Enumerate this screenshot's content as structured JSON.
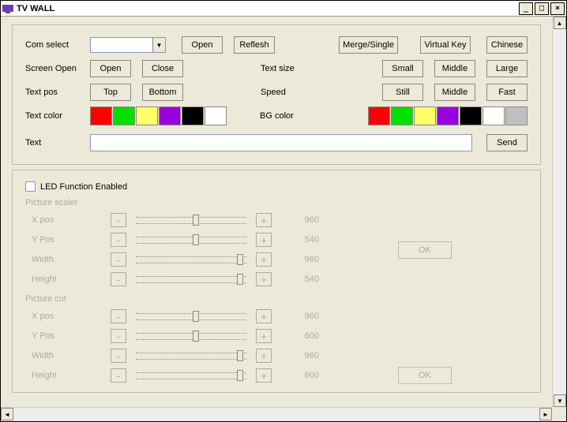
{
  "title": "TV WALL",
  "top": {
    "com_select_label": "Com select",
    "open": "Open",
    "reflesh": "Reflesh",
    "merge_single": "Merge/Single",
    "virtual_key": "Virtual Key",
    "chinese": "Chinese",
    "screen_open_label": "Screen Open",
    "screen_open": "Open",
    "screen_close": "Close",
    "text_size_label": "Text size",
    "small": "Small",
    "middle": "Middle",
    "large": "Large",
    "text_pos_label": "Text pos",
    "top_btn": "Top",
    "bottom_btn": "Bottom",
    "speed_label": "Speed",
    "still": "Still",
    "fast": "Fast",
    "text_color_label": "Text color",
    "bg_color_label": "BG color",
    "text_label": "Text",
    "send": "Send",
    "text_value": "",
    "colors1": [
      "#ff0000",
      "#00e000",
      "#ffff66",
      "#9900dd",
      "#000000",
      "#ffffff"
    ],
    "colors2": [
      "#ff0000",
      "#00e000",
      "#ffff66",
      "#9900dd",
      "#000000",
      "#ffffff",
      "#c0c0c0"
    ]
  },
  "led": {
    "checkbox_label": "LED Function Enabled",
    "scaler_label": "Picture scaler",
    "cut_label": "Picture cut",
    "minus": "-",
    "plus": "+",
    "ok": "OK",
    "scaler": {
      "rows": [
        {
          "label": "X pos",
          "val": "960",
          "thumb": 72
        },
        {
          "label": "Y Pos",
          "val": "540",
          "thumb": 72
        },
        {
          "label": "Width",
          "val": "960",
          "thumb": 128
        },
        {
          "label": "Height",
          "val": "540",
          "thumb": 128
        }
      ]
    },
    "cut": {
      "rows": [
        {
          "label": "X pos",
          "val": "960",
          "thumb": 72
        },
        {
          "label": "Y Pos",
          "val": "600",
          "thumb": 72
        },
        {
          "label": "Width",
          "val": "960",
          "thumb": 128
        },
        {
          "label": "Height",
          "val": "600",
          "thumb": 128
        }
      ]
    }
  }
}
